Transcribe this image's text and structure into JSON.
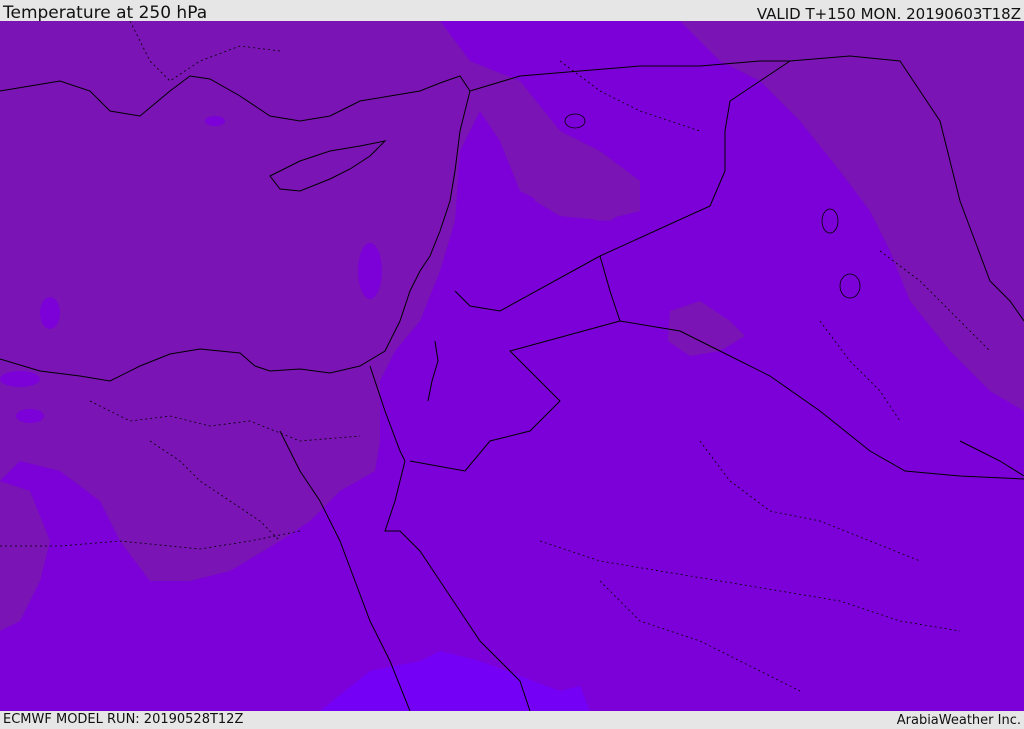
{
  "header": {
    "title": "Temperature at 250 hPa",
    "valid": "VALID T+150 MON. 20190603T18Z"
  },
  "footer": {
    "model_run": "ECMWF MODEL RUN: 20190528T12Z",
    "credit": "ArabiaWeather Inc."
  },
  "colors": {
    "bar_background": "#e6e6e6",
    "field_warm": "#7a14b4",
    "field_mid": "#7c00d8",
    "field_cold": "#7400f6",
    "coastline": "#000000"
  }
}
